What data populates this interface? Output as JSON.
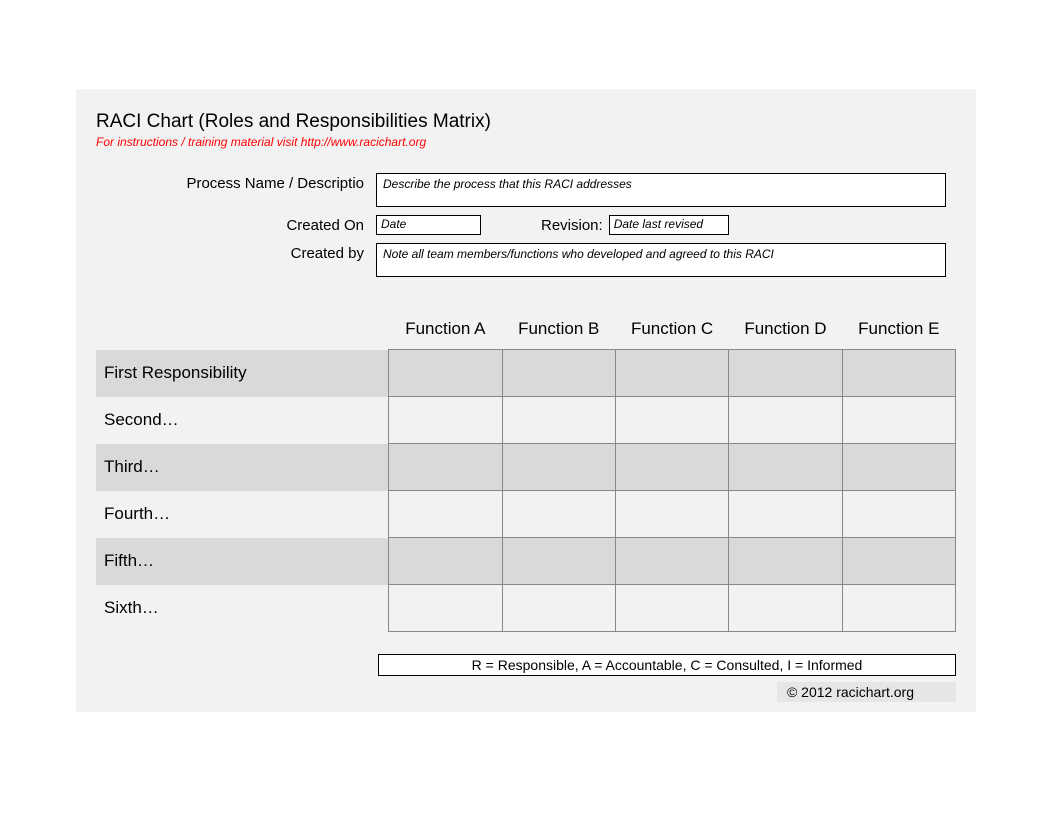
{
  "header": {
    "title": "RACI Chart (Roles and Responsibilities Matrix)",
    "subtitle": "For instructions / training material visit http://www.racichart.org"
  },
  "form": {
    "process_label": "Process Name / Descriptio",
    "process_placeholder": "Describe the process that this RACI addresses",
    "created_on_label": "Created On",
    "created_on_placeholder": "Date",
    "revision_label": "Revision:",
    "revision_placeholder": "Date last revised",
    "created_by_label": "Created by",
    "created_by_placeholder": "Note all team members/functions who developed and agreed to this RACI"
  },
  "matrix": {
    "columns": [
      "Function A",
      "Function B",
      "Function C",
      "Function D",
      "Function E"
    ],
    "rows": [
      "First Responsibility",
      "Second…",
      "Third…",
      "Fourth…",
      "Fifth…",
      "Sixth…"
    ]
  },
  "legend": "R = Responsible, A = Accountable, C = Consulted, I = Informed",
  "footer": "© 2012 racichart.org"
}
